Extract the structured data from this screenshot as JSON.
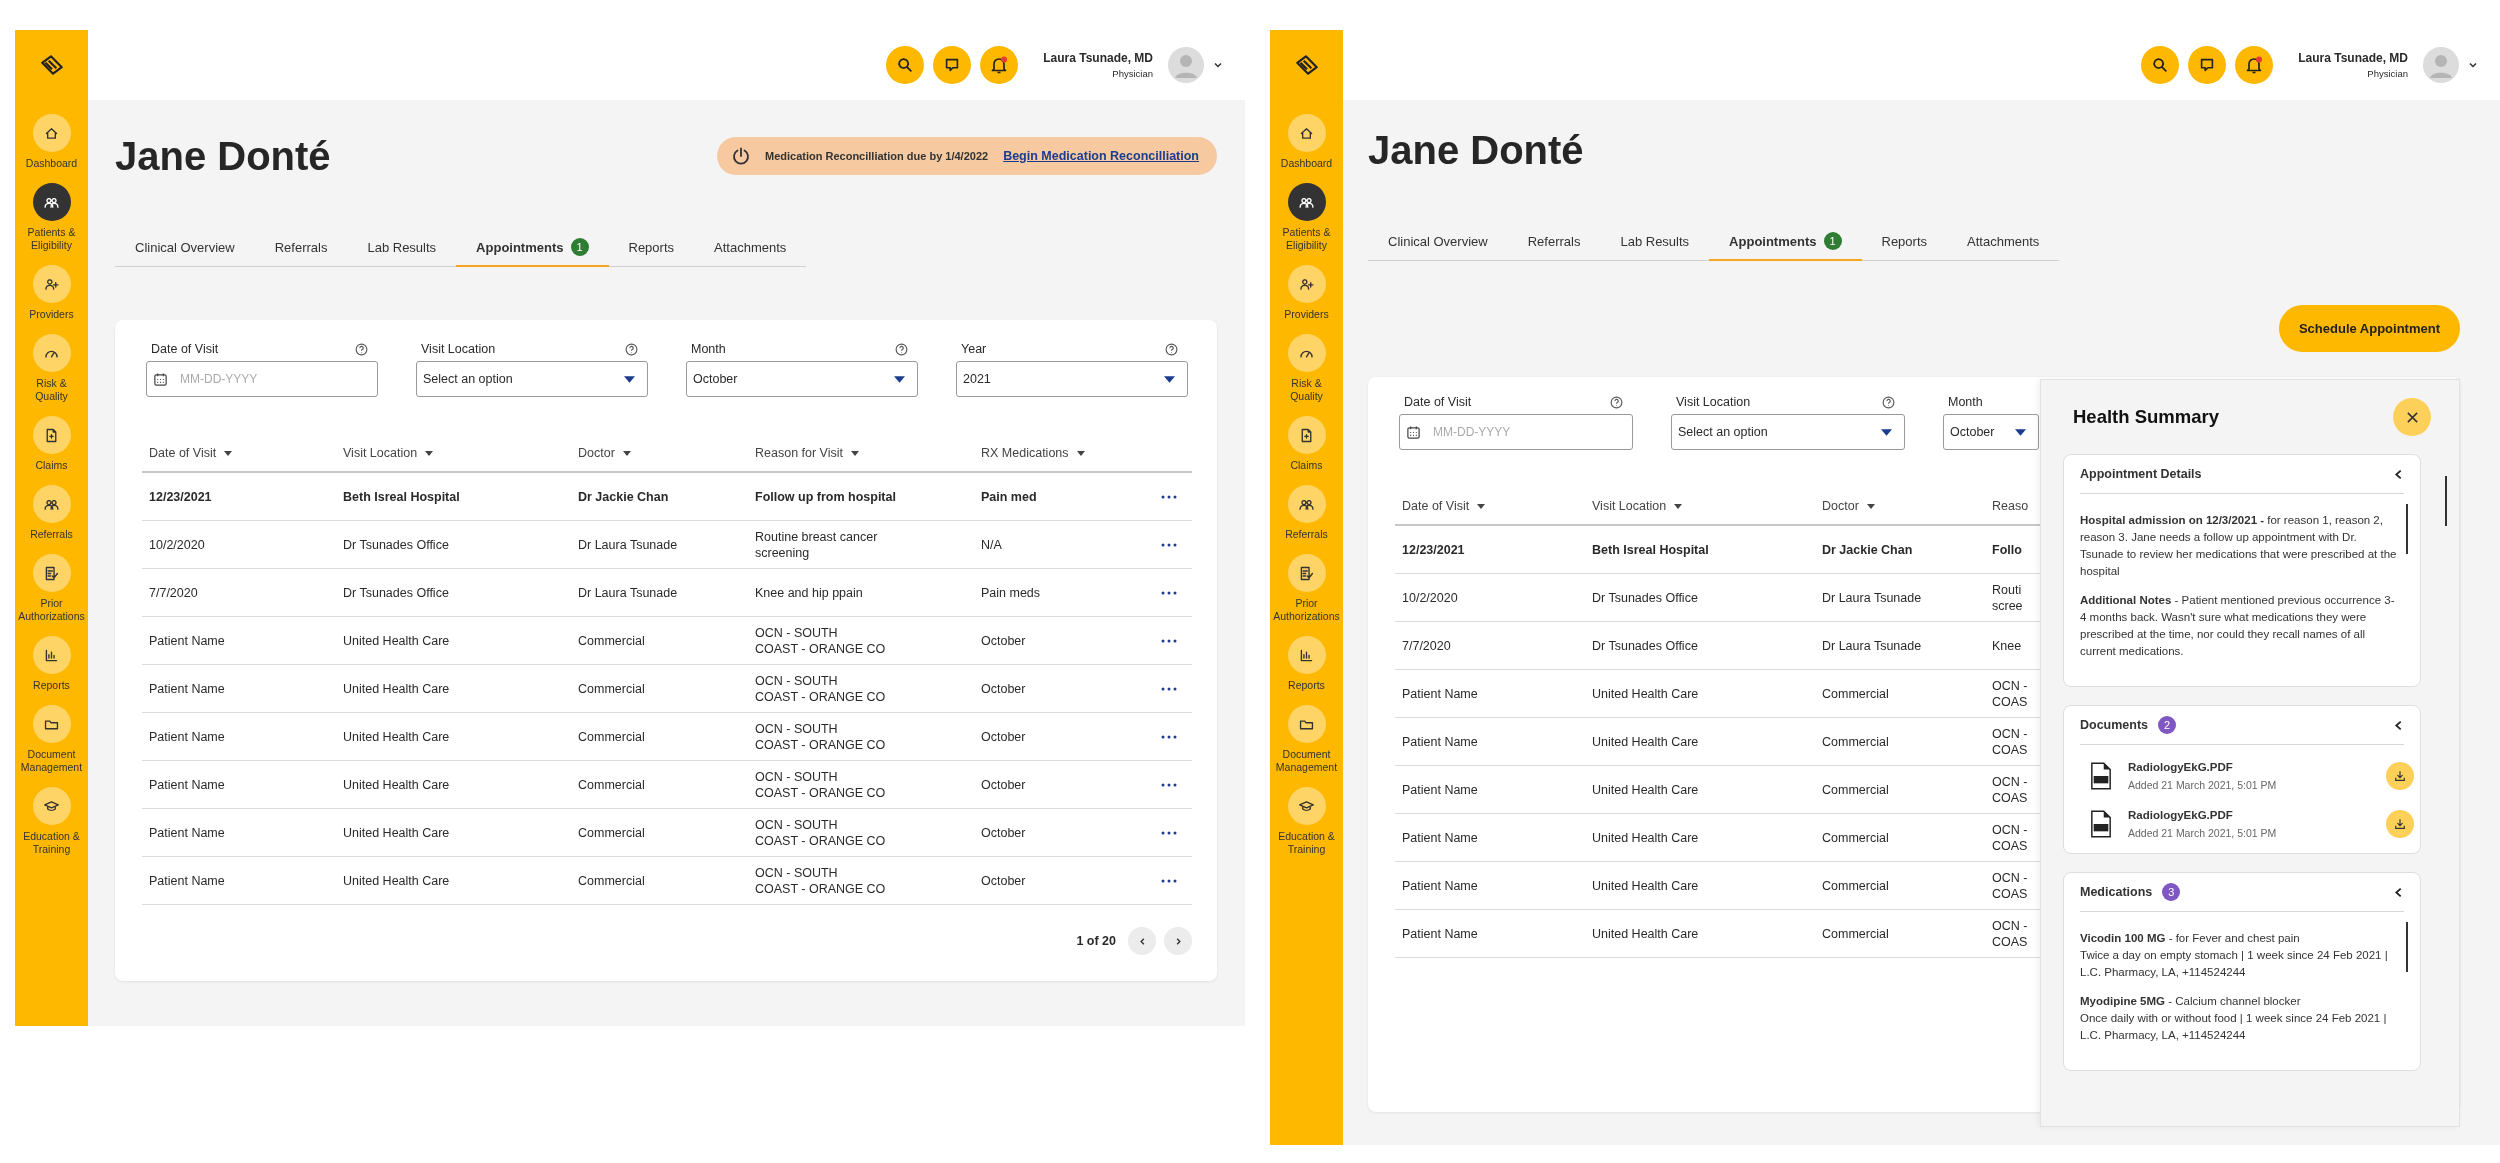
{
  "screens": [
    {
      "sidebar": {
        "items": [
          {
            "label": "Dashboard",
            "selected": false
          },
          {
            "label": "Patients &\nEligibility",
            "selected": true
          },
          {
            "label": "Providers",
            "selected": false
          },
          {
            "label": "Risk &\nQuality",
            "selected": false
          },
          {
            "label": "Claims",
            "selected": false
          },
          {
            "label": "Referrals",
            "selected": false
          },
          {
            "label": "Prior\nAuthorizations",
            "selected": false
          },
          {
            "label": "Reports",
            "selected": false
          },
          {
            "label": "Document\nManagement",
            "selected": false
          },
          {
            "label": "Education &\nTraining",
            "selected": false
          }
        ]
      },
      "user": {
        "name": "Laura Tsunade, MD",
        "role": "Physician"
      },
      "patient_name": "Jane Donté",
      "banner": {
        "text": "Medication Reconcilliation due by 1/4/2022",
        "link": "Begin Medication Reconcilliation"
      },
      "tabs": [
        {
          "label": "Clinical Overview",
          "selected": false
        },
        {
          "label": "Referrals",
          "selected": false
        },
        {
          "label": "Lab Results",
          "selected": false
        },
        {
          "label": "Appointments",
          "selected": true,
          "badge": "1"
        },
        {
          "label": "Reports",
          "selected": false
        },
        {
          "label": "Attachments",
          "selected": false
        }
      ],
      "filters": [
        {
          "kind": "date",
          "label": "Date of Visit",
          "placeholder": "MM-DD-YYYY",
          "help": true
        },
        {
          "kind": "select",
          "label": "Visit Location",
          "value": "Select an option",
          "help": true
        },
        {
          "kind": "select",
          "label": "Month",
          "value": "October",
          "help": true
        },
        {
          "kind": "select",
          "label": "Year",
          "value": "2021",
          "help": true
        }
      ],
      "table": {
        "row_actions": true,
        "columns": [
          {
            "label": "Date of Visit",
            "sortable": true
          },
          {
            "label": "Visit Location",
            "sortable": true
          },
          {
            "label": "Doctor",
            "sortable": true
          },
          {
            "label": "Reason for Visit",
            "sortable": true
          },
          {
            "label": "RX Medications",
            "sortable": true
          }
        ],
        "rows": [
          {
            "bold": true,
            "cells": [
              "12/23/2021",
              "Beth Isreal Hospital",
              "Dr Jackie Chan",
              "Follow up from hospital",
              "Pain med"
            ]
          },
          {
            "bold": false,
            "cells": [
              "10/2/2020",
              "Dr Tsunades Office",
              "Dr Laura Tsunade",
              "Routine breast cancer\nscreening",
              "N/A"
            ]
          },
          {
            "bold": false,
            "cells": [
              "7/7/2020",
              "Dr Tsunades Office",
              "Dr Laura Tsunade",
              "Knee and hip ppain",
              "Pain meds"
            ]
          },
          {
            "bold": false,
            "cells": [
              "Patient Name",
              "United Health Care",
              "Commercial",
              "OCN - SOUTH\nCOAST - ORANGE CO",
              "October"
            ]
          },
          {
            "bold": false,
            "cells": [
              "Patient Name",
              "United Health Care",
              "Commercial",
              "OCN - SOUTH\nCOAST - ORANGE CO",
              "October"
            ]
          },
          {
            "bold": false,
            "cells": [
              "Patient Name",
              "United Health Care",
              "Commercial",
              "OCN - SOUTH\nCOAST - ORANGE CO",
              "October"
            ]
          },
          {
            "bold": false,
            "cells": [
              "Patient Name",
              "United Health Care",
              "Commercial",
              "OCN - SOUTH\nCOAST - ORANGE CO",
              "October"
            ]
          },
          {
            "bold": false,
            "cells": [
              "Patient Name",
              "United Health Care",
              "Commercial",
              "OCN - SOUTH\nCOAST - ORANGE CO",
              "October"
            ]
          },
          {
            "bold": false,
            "cells": [
              "Patient Name",
              "United Health Care",
              "Commercial",
              "OCN - SOUTH\nCOAST - ORANGE CO",
              "October"
            ]
          }
        ]
      },
      "pagination": {
        "text": "1 of 20"
      }
    },
    {
      "sidebar": {
        "items": [
          {
            "label": "Dashboard",
            "selected": false
          },
          {
            "label": "Patients &\nEligibility",
            "selected": true
          },
          {
            "label": "Providers",
            "selected": false
          },
          {
            "label": "Risk &\nQuality",
            "selected": false
          },
          {
            "label": "Claims",
            "selected": false
          },
          {
            "label": "Referrals",
            "selected": false
          },
          {
            "label": "Prior\nAuthorizations",
            "selected": false
          },
          {
            "label": "Reports",
            "selected": false
          },
          {
            "label": "Document\nManagement",
            "selected": false
          },
          {
            "label": "Education &\nTraining",
            "selected": false
          }
        ]
      },
      "user": {
        "name": "Laura Tsunade, MD",
        "role": "Physician"
      },
      "patient_name": "Jane Donté",
      "tabs": [
        {
          "label": "Clinical Overview",
          "selected": false
        },
        {
          "label": "Referrals",
          "selected": false
        },
        {
          "label": "Lab Results",
          "selected": false
        },
        {
          "label": "Appointments",
          "selected": true,
          "badge": "1"
        },
        {
          "label": "Reports",
          "selected": false
        },
        {
          "label": "Attachments",
          "selected": false
        }
      ],
      "schedule_button": "Schedule Appointment",
      "filters": [
        {
          "kind": "date",
          "label": "Date of Visit",
          "placeholder": "MM-DD-YYYY",
          "help": true
        },
        {
          "kind": "select",
          "label": "Visit Location",
          "value": "Select an option",
          "help": true
        },
        {
          "kind": "select",
          "label": "Month",
          "value": "October",
          "help": false
        }
      ],
      "table": {
        "row_actions": false,
        "columns": [
          {
            "label": "Date of Visit",
            "sortable": true
          },
          {
            "label": "Visit Location",
            "sortable": true
          },
          {
            "label": "Doctor",
            "sortable": true
          },
          {
            "label": "Reaso",
            "sortable": false
          }
        ],
        "rows": [
          {
            "bold": true,
            "cells": [
              "12/23/2021",
              "Beth Isreal Hospital",
              "Dr Jackie Chan",
              "Follo"
            ]
          },
          {
            "bold": false,
            "cells": [
              "10/2/2020",
              "Dr Tsunades Office",
              "Dr Laura Tsunade",
              "Routi\nscree"
            ]
          },
          {
            "bold": false,
            "cells": [
              "7/7/2020",
              "Dr Tsunades Office",
              "Dr Laura Tsunade",
              "Knee"
            ]
          },
          {
            "bold": false,
            "cells": [
              "Patient Name",
              "United Health Care",
              "Commercial",
              "OCN -\nCOAS"
            ]
          },
          {
            "bold": false,
            "cells": [
              "Patient Name",
              "United Health Care",
              "Commercial",
              "OCN -\nCOAS"
            ]
          },
          {
            "bold": false,
            "cells": [
              "Patient Name",
              "United Health Care",
              "Commercial",
              "OCN -\nCOAS"
            ]
          },
          {
            "bold": false,
            "cells": [
              "Patient Name",
              "United Health Care",
              "Commercial",
              "OCN -\nCOAS"
            ]
          },
          {
            "bold": false,
            "cells": [
              "Patient Name",
              "United Health Care",
              "Commercial",
              "OCN -\nCOAS"
            ]
          },
          {
            "bold": false,
            "cells": [
              "Patient Name",
              "United Health Care",
              "Commercial",
              "OCN -\nCOAS"
            ]
          }
        ]
      },
      "health_summary": {
        "title": "Health Summary",
        "sections": [
          {
            "kind": "notes",
            "title": "Appointment Details",
            "paragraphs": [
              "**Hospital admission on 12/3/2021 -** for reason 1, reason 2, reason 3. Jane needs a follow up appointment with Dr. Tsunade to review her medications that were prescribed at the hospital",
              "**Additional Notes** - Patient mentioned previous occurrence 3-4 months back. Wasn't sure what medications they were prescribed at the time, nor could they recall names of all current medications."
            ]
          },
          {
            "kind": "documents",
            "title": "Documents",
            "badge": "2",
            "items": [
              {
                "name": "RadiologyEkG.PDF",
                "added": "Added 21 March 2021, 5:01 PM"
              },
              {
                "name": "RadiologyEkG.PDF",
                "added": "Added 21 March 2021, 5:01 PM"
              }
            ]
          },
          {
            "kind": "medications",
            "title": "Medications",
            "badge": "3",
            "items": [
              "**Vicodin 100 MG** - for Fever and chest pain\nTwice a day on empty stomach  |  1 week since 24 Feb 2021  |\nL.C. Pharmacy, LA, +114524244",
              "**Myodipine 5MG** - Calcium channel blocker\nOnce daily with or without food  |  1 week since 24 Feb 2021  |\nL.C. Pharmacy, LA, +114524244"
            ]
          }
        ]
      }
    }
  ]
}
